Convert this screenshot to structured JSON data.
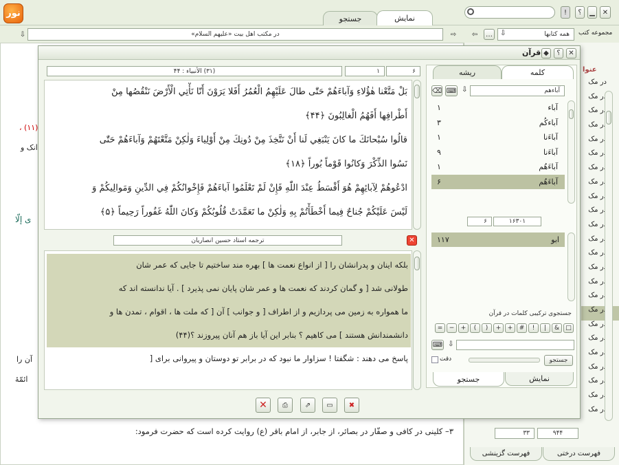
{
  "top": {
    "tab_show": "نمایش",
    "tab_search": "جستجو",
    "search_value": ""
  },
  "toolbar": {
    "location": "در مکتب اهل بیت «علیهم السلام»",
    "collection_label": "مجموعه کتب",
    "collection_value": "همه کتابها"
  },
  "right_panel": {
    "header": "عنوا",
    "rows": [
      "در مک",
      "در مک",
      "در مک",
      "در مک",
      "در مک",
      "در مک",
      "در مک",
      "در مک",
      "در مک",
      "در مک",
      "در مک",
      "در مک",
      "در مک",
      "در مک",
      "در مک",
      "در مک",
      "در مک",
      "در مک",
      "در مک",
      "در مک",
      "در مک",
      "در مک",
      "در مک",
      "در مک"
    ],
    "selected_index": 16,
    "page_a": "۹۴۴",
    "page_b": "۳۳",
    "tab_tree": "فهرست درختی",
    "tab_select": "فهرست گزینشی"
  },
  "background": {
    "line1": "۳– کلینی در کافی و صفّار در بصائر، از جابر، از امام باقر (ع) روایت کرده است که حضرت فرمود:",
    "frag1": "(۱۱) ،",
    "frag2": "انک و",
    "frag3": "ی إلّا",
    "frag4": "آن را",
    "frag5": "ائمّهٔ"
  },
  "dialog": {
    "title": "قرآن",
    "ref": "(۳۱) الأنبیاء : ۴۴",
    "ref_num_a": "۶",
    "ref_num_b": "۱",
    "verses": [
      "بَلْ مَتَّعْنا هٰؤُلاءِ وَآباءَهُمْ حَتّٰى طالَ عَلَيْهِمُ الْعُمُرُ أَفَلا يَرَوْنَ أَنّا نَأْتِي الْأَرْضَ نَنْقُصُها مِنْ",
      "أَطْرافِها أَفَهُمُ الْغالِبُونَ ﴿۴۴﴾",
      "قالُوا سُبْحانَكَ ما كانَ يَنْبَغِي لَنا أَنْ نَتَّخِذَ مِنْ دُونِكَ مِنْ أَوْلِياءَ وَلٰكِنْ مَتَّعْتَهُمْ وَآباءَهُمْ حَتّٰى",
      "نَسُوا الذِّكْرَ وَكانُوا قَوْماً بُوراً ﴿۱۸﴾",
      "ادْعُوهُمْ لِآبائِهِمْ هُوَ أَقْسَطُ عِنْدَ اللّٰهِ فَإِنْ لَمْ تَعْلَمُوا آباءَهُمْ فَإِخْوانُكُمْ فِي الدِّينِ وَمَوالِيكُمْ وَ",
      "لَيْسَ عَلَيْكُمْ جُناحٌ فِيما أَخْطَأْتُمْ بِهِ وَلٰكِنْ ما تَعَمَّدَتْ قُلُوبُكُمْ وَكانَ اللّٰهُ غَفُوراً رَحِيماً ﴿۵﴾"
    ],
    "translator": "ترجمه استاد حسین انصاریان",
    "translation": [
      "بلکه اینان و پدرانشان را [ از انواع نعمت ها ] بهره مند ساختیم تا جایی که عمر شان",
      "طولانی شد [ و گمان کردند که نعمت ها و عمر شان پایان نمی پذیرد ] . آیا ندانسته اند که",
      "ما همواره به زمین می پردازیم و از اطراف [ و جوانب ] آن [ که ملت ها ، اقوام ، تمدن ها و",
      "دانشمندانش هستند ] می کاهیم ؟ بنابر این آیا باز هم آنان پیروزند ؟(۴۴)",
      "پاسخ می دهند : شگفتا ! سزاوار ما نبود که در برابر تو دوستان و پیروانی برای ["
    ],
    "highlighted_lines": 4,
    "tab_word": "کلمه",
    "tab_root": "ریشه",
    "word_input": "آباءهم",
    "words": [
      {
        "w": "آباء",
        "c": "۱"
      },
      {
        "w": "آباءکُم",
        "c": "۳"
      },
      {
        "w": "آباءَنا",
        "c": "۱"
      },
      {
        "w": "آباءَنا",
        "c": "۹"
      },
      {
        "w": "آباءَهُم",
        "c": "۱"
      },
      {
        "w": "آباءَهُم",
        "c": "۶"
      }
    ],
    "selected_word": 5,
    "stat_a": "۱۶۳۰۱",
    "stat_b": "۶",
    "roots": [
      {
        "w": "ابو",
        "c": "۱۱۷"
      }
    ],
    "combo_label": "جستجوی ترکیبی کلمات در قرآن",
    "ops": [
      "□",
      "&",
      "|",
      "!",
      "#",
      "+",
      "+",
      "(",
      ")",
      "+",
      "−",
      "="
    ],
    "search_btn": "جستجو",
    "exact_label": "دقت",
    "bottom_tab_show": "نمایش",
    "bottom_tab_search": "جستجو"
  }
}
